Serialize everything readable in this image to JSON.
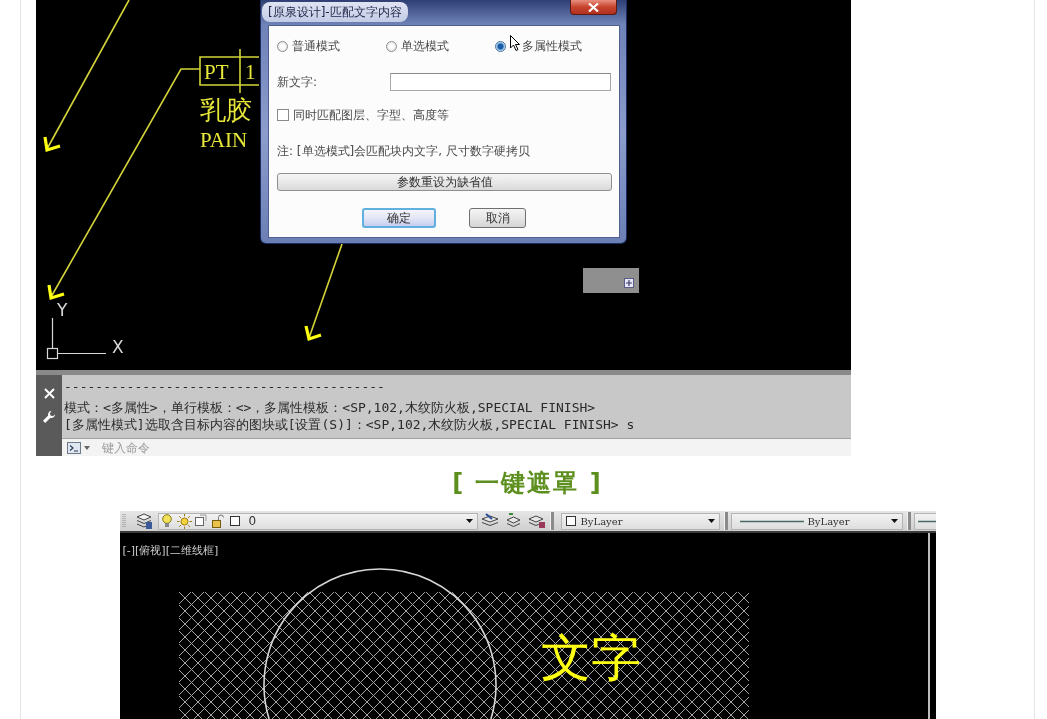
{
  "top_screenshot": {
    "drawing": {
      "tag": {
        "code": "PT",
        "number": "1"
      },
      "labels": [
        "乳胶",
        "PAIN"
      ],
      "ucs": {
        "x_label": "X",
        "y_label": "Y"
      }
    },
    "dialog": {
      "title": "[原泉设计]-匹配文字内容",
      "modes": [
        {
          "label": "普通模式",
          "selected": false
        },
        {
          "label": "单选模式",
          "selected": false
        },
        {
          "label": "多属性模式",
          "selected": true
        }
      ],
      "new_text": {
        "label": "新文字:"
      },
      "match_option": {
        "label": "同时匹配图层、字型、高度等",
        "checked": false
      },
      "note": "注: [单选模式]会匹配块内文字, 尺寸数字硬拷贝",
      "reset_button": "参数重设为缺省值",
      "buttons": [
        {
          "label": "确定",
          "focused": true
        },
        {
          "label": "取消",
          "focused": false
        }
      ]
    },
    "command_line": {
      "history": [
        "-----------------------------------------",
        "模式：<多属性>，单行模板：<>，多属性模板：<SP,102,木纹防火板,SPECIAL FINISH>",
        "[多属性模式]选取含目标内容的图块或[设置(S)]：<SP,102,木纹防火板,SPECIAL FINISH> s"
      ],
      "placeholder": "键入命令"
    }
  },
  "caption": "[ 一键遮罩 ]",
  "bottom_screenshot": {
    "toolbar": {
      "layer": "0",
      "color_setting": "ByLayer",
      "linetype": "ByLayer"
    },
    "viewport_label": "[-][俯视][二维线框]",
    "drawing_text": "文字"
  }
}
